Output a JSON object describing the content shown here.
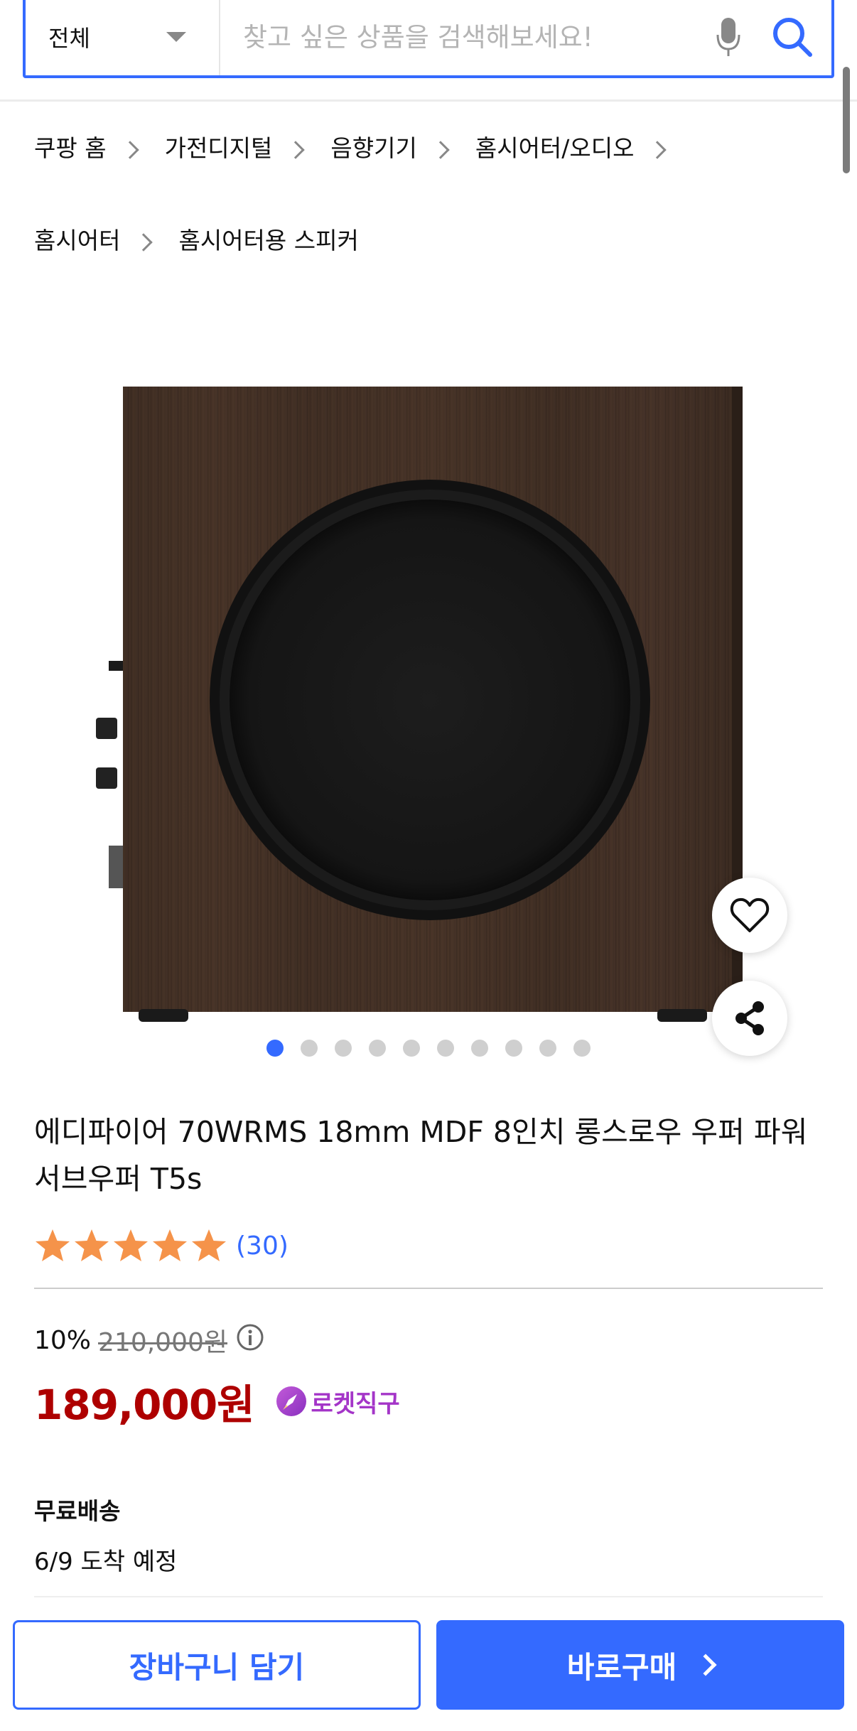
{
  "search": {
    "category_label": "전체",
    "placeholder": "찾고 싶은 상품을 검색해보세요!"
  },
  "breadcrumb": [
    {
      "label": "쿠팡 홈"
    },
    {
      "label": "가전디지털"
    },
    {
      "label": "음향기기"
    },
    {
      "label": "홈시어터/오디오"
    },
    {
      "label": "홈시어터"
    },
    {
      "label": "홈시어터용 스피커"
    }
  ],
  "gallery": {
    "image_count": 10,
    "active_index": 0
  },
  "product": {
    "title": "에디파이어 70WRMS 18mm MDF 8인치 롱스로우 우퍼 파워 서브우퍼 T5s",
    "rating": 5,
    "review_count": "(30)",
    "discount_rate": "10%",
    "original_price": "210,000원",
    "sale_price": "189,000원",
    "badge_label": "로켓직구"
  },
  "shipping": {
    "title": "무료배송",
    "arrival": "6/9 도착 예정"
  },
  "actions": {
    "cart_label": "장바구니 담기",
    "buy_label": "바로구매"
  },
  "colors": {
    "accent": "#346aff",
    "price": "#ae0000",
    "badge": "#a435c8",
    "star": "#f5934a"
  }
}
